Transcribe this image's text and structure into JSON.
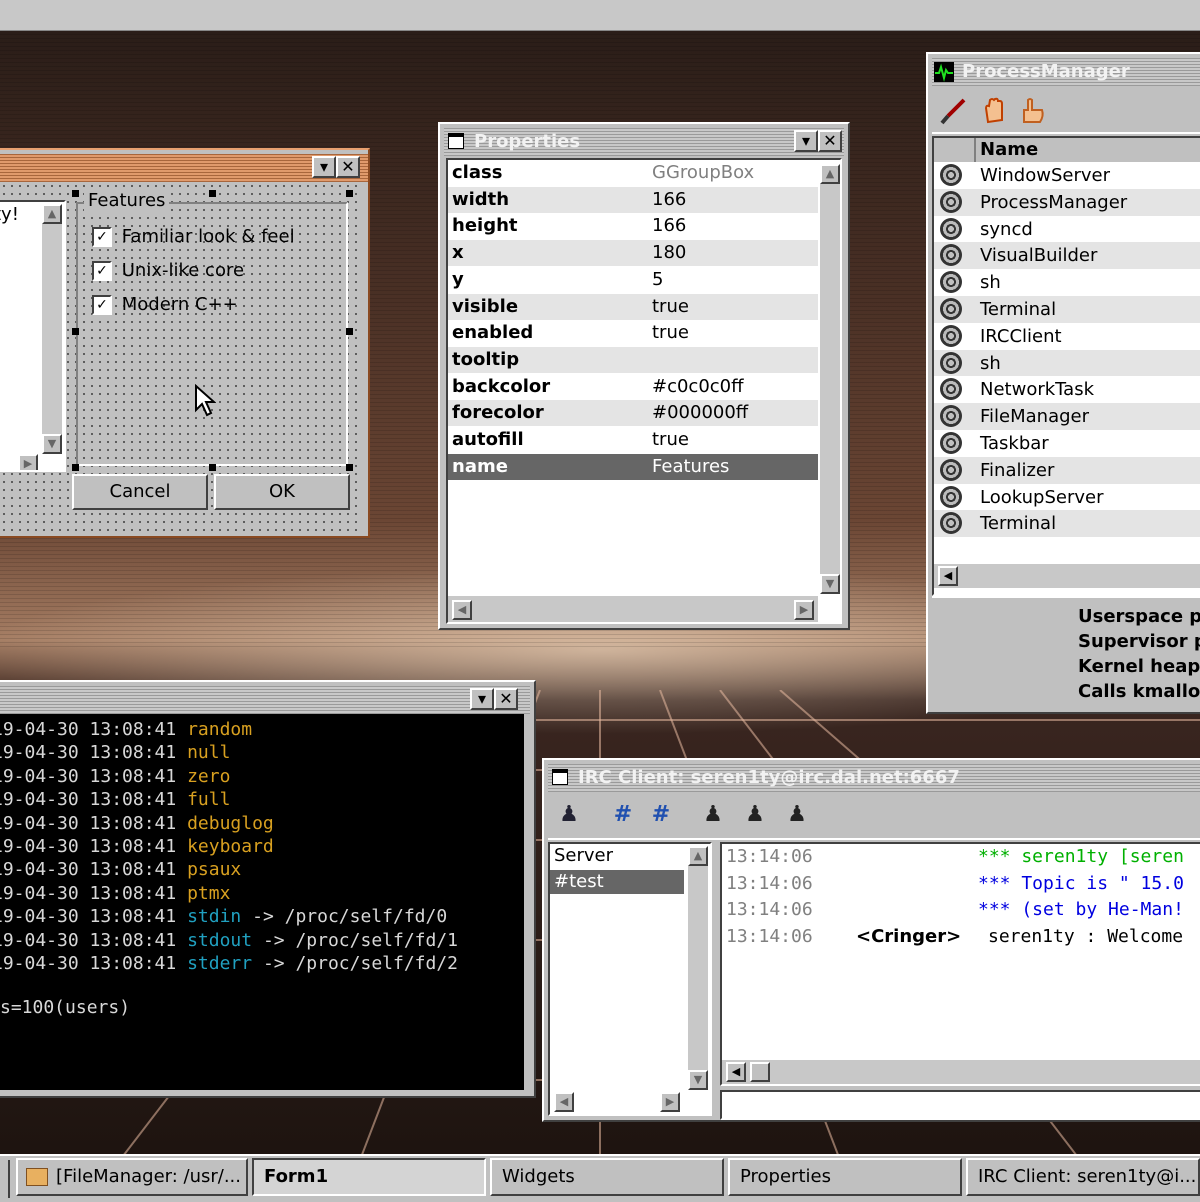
{
  "form_window": {
    "groupbox_title": "Features",
    "checkboxes": [
      "Familiar look & feel",
      "Unix-like core",
      "Modern C++"
    ],
    "list_partial_text": "ty!",
    "cancel_label": "Cancel",
    "ok_label": "OK"
  },
  "properties_window": {
    "title": "Properties",
    "rows": [
      {
        "key": "class",
        "value": "GGroupBox"
      },
      {
        "key": "width",
        "value": "166"
      },
      {
        "key": "height",
        "value": "166"
      },
      {
        "key": "x",
        "value": "180"
      },
      {
        "key": "y",
        "value": "5"
      },
      {
        "key": "visible",
        "value": "true"
      },
      {
        "key": "enabled",
        "value": "true"
      },
      {
        "key": "tooltip",
        "value": ""
      },
      {
        "key": "backcolor",
        "value": "#c0c0c0ff"
      },
      {
        "key": "forecolor",
        "value": "#000000ff"
      },
      {
        "key": "autofill",
        "value": "true"
      },
      {
        "key": "name",
        "value": "Features"
      }
    ],
    "selected_row": "name"
  },
  "process_manager": {
    "title": "ProcessManager",
    "column_name": "Name",
    "processes": [
      "WindowServer",
      "ProcessManager",
      "syncd",
      "VisualBuilder",
      "sh",
      "Terminal",
      "IRCClient",
      "sh",
      "NetworkTask",
      "FileManager",
      "Taskbar",
      "Finalizer",
      "LookupServer",
      "Terminal"
    ],
    "memory_labels": [
      "Userspace p",
      "Supervisor p",
      "Kernel heap",
      "Calls kmallo"
    ]
  },
  "terminal": {
    "lines": [
      {
        "ts": "19-04-30 13:08:41",
        "name": "random",
        "target": ""
      },
      {
        "ts": "19-04-30 13:08:41",
        "name": "null",
        "target": ""
      },
      {
        "ts": "19-04-30 13:08:41",
        "name": "zero",
        "target": ""
      },
      {
        "ts": "19-04-30 13:08:41",
        "name": "full",
        "target": ""
      },
      {
        "ts": "19-04-30 13:08:41",
        "name": "debuglog",
        "target": ""
      },
      {
        "ts": "19-04-30 13:08:41",
        "name": "keyboard",
        "target": ""
      },
      {
        "ts": "19-04-30 13:08:41",
        "name": "psaux",
        "target": ""
      },
      {
        "ts": "19-04-30 13:08:41",
        "name": "ptmx",
        "target": ""
      },
      {
        "ts": "19-04-30 13:08:41",
        "name": "stdin",
        "target": " -> /proc/self/fd/0"
      },
      {
        "ts": "19-04-30 13:08:41",
        "name": "stdout",
        "target": " -> /proc/self/fd/1"
      },
      {
        "ts": "19-04-30 13:08:41",
        "name": "stderr",
        "target": " -> /proc/self/fd/2"
      }
    ],
    "prompt_tail": "s=100(users)"
  },
  "irc": {
    "title": "IRC Client: seren1ty@irc.dal.net:6667",
    "channels": [
      "Server",
      "#test"
    ],
    "selected_channel": "#test",
    "messages": [
      {
        "time": "13:14:06",
        "nick": "",
        "text": "*** seren1ty [seren",
        "color": "#00b000"
      },
      {
        "time": "13:14:06",
        "nick": "",
        "text": "*** Topic is \" 15.0",
        "color": "#0000e0"
      },
      {
        "time": "13:14:06",
        "nick": "",
        "text": "*** (set by He-Man!",
        "color": "#0000e0"
      },
      {
        "time": "13:14:06",
        "nick": "<Cringer>",
        "text": "seren1ty : Welcome",
        "color": "#000000"
      }
    ]
  },
  "taskbar": {
    "items": [
      "[FileManager: /usr/...",
      "Form1",
      "Widgets",
      "Properties",
      "IRC Client: seren1ty@i..."
    ]
  },
  "colors": {
    "active_title": "#e09a6c",
    "selection": "#666666",
    "terminal_yellow": "#d8a020",
    "terminal_cyan": "#20a0c0",
    "desktop_sunset": "#6b4634"
  },
  "icons": {
    "process_manager": "activity-graph-icon",
    "process_row": "gear-icon",
    "pm_toolbar": [
      "brush-icon",
      "stop-hand-icon",
      "continue-hand-icon"
    ],
    "irc_toolbar": [
      "user-icon",
      "join-channel-icon",
      "part-channel-icon",
      "op-icon",
      "voice-add-icon",
      "kick-user-icon"
    ]
  }
}
